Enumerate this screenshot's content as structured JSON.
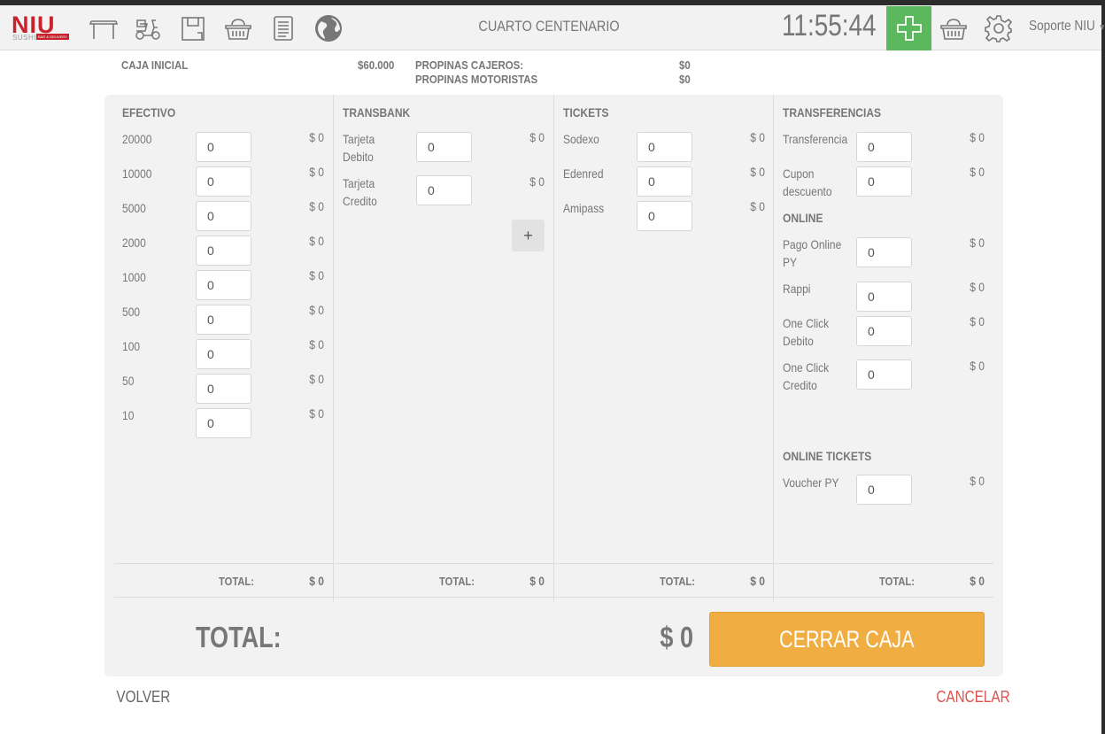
{
  "header": {
    "logo_text": "NIU",
    "logo_sub": "SUSHI",
    "logo_badge": "BAR & DELIVERY",
    "store_name": "CUARTO CENTENARIO",
    "clock": "11:55:44",
    "user": "Soporte NIU",
    "icons": [
      "table-icon",
      "scooter-icon",
      "bag-icon",
      "basket-icon",
      "receipt-icon",
      "globe-icon"
    ],
    "accent_color": "#5cb85c",
    "brand_color": "#c8232c"
  },
  "info": {
    "caja_inicial_label": "CAJA INICIAL",
    "caja_inicial_value": "$60.000",
    "propinas_cajeros_label": "PROPINAS CAJEROS:",
    "propinas_cajeros_value": "$0",
    "propinas_motoristas_label": "PROPINAS MOTORISTAS",
    "propinas_motoristas_value": "$0"
  },
  "columns": {
    "efectivo": {
      "title": "EFECTIVO",
      "rows": [
        {
          "label": "20000",
          "value": "0",
          "amount": "$ 0"
        },
        {
          "label": "10000",
          "value": "0",
          "amount": "$ 0"
        },
        {
          "label": "5000",
          "value": "0",
          "amount": "$ 0"
        },
        {
          "label": "2000",
          "value": "0",
          "amount": "$ 0"
        },
        {
          "label": "1000",
          "value": "0",
          "amount": "$ 0"
        },
        {
          "label": "500",
          "value": "0",
          "amount": "$ 0"
        },
        {
          "label": "100",
          "value": "0",
          "amount": "$ 0"
        },
        {
          "label": "50",
          "value": "0",
          "amount": "$ 0"
        },
        {
          "label": "10",
          "value": "0",
          "amount": "$ 0"
        }
      ],
      "total_label": "TOTAL:",
      "total_value": "$ 0"
    },
    "transbank": {
      "title": "TRANSBANK",
      "rows": [
        {
          "label": "Tarjeta Debito",
          "value": "0",
          "amount": "$ 0"
        },
        {
          "label": "Tarjeta Credito",
          "value": "0",
          "amount": "$ 0"
        }
      ],
      "add_label": "+",
      "total_label": "TOTAL:",
      "total_value": "$ 0"
    },
    "tickets": {
      "title": "TICKETS",
      "rows": [
        {
          "label": "Sodexo",
          "value": "0",
          "amount": "$ 0"
        },
        {
          "label": "Edenred",
          "value": "0",
          "amount": "$ 0"
        },
        {
          "label": "Amipass",
          "value": "0",
          "amount": "$ 0"
        }
      ],
      "total_label": "TOTAL:",
      "total_value": "$ 0"
    },
    "transferencias": {
      "title": "TRANSFERENCIAS",
      "rows": [
        {
          "label": "Transferencia",
          "value": "0",
          "amount": "$ 0"
        },
        {
          "label": "Cupon descuento",
          "value": "0",
          "amount": "$ 0"
        }
      ],
      "online_title": "ONLINE",
      "online_rows": [
        {
          "label": "Pago Online PY",
          "value": "0",
          "amount": "$ 0"
        },
        {
          "label": "Rappi",
          "value": "0",
          "amount": "$ 0"
        },
        {
          "label": "One Click Debito",
          "value": "0",
          "amount": "$ 0"
        },
        {
          "label": "One Click Credito",
          "value": "0",
          "amount": "$ 0"
        }
      ],
      "online_tickets_title": "ONLINE TICKETS",
      "online_tickets_rows": [
        {
          "label": "Voucher PY",
          "value": "0",
          "amount": "$ 0"
        }
      ],
      "total_label": "TOTAL:",
      "total_value": "$ 0"
    }
  },
  "grand_total": {
    "label": "TOTAL:",
    "value": "$ 0"
  },
  "actions": {
    "close_label": "CERRAR CAJA",
    "close_color": "#f0ad41",
    "back_label": "VOLVER",
    "cancel_label": "CANCELAR",
    "cancel_color": "#d9534f"
  }
}
